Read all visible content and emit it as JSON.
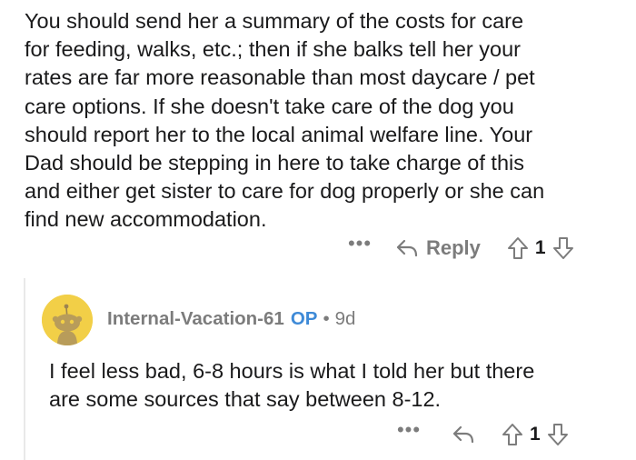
{
  "parent_comment": {
    "lines": [
      "You should send her a summary of the costs for care",
      "for feeding, walks, etc.; then if she balks tell her your",
      "rates are far more reasonable than most daycare / pet",
      "care options. If she doesn't take care of the dog you",
      "should report her to the local animal welfare line. Your",
      "Dad should be stepping in here to take charge of this",
      "and either get sister to care for dog properly or she can",
      "find new accommodation."
    ],
    "actions": {
      "more_label": "•••",
      "reply_label": "Reply",
      "vote_count": "1"
    }
  },
  "reply_comment": {
    "username": "Internal-Vacation-61",
    "op_badge": "OP",
    "separator": "•",
    "age": "9d",
    "lines": [
      "I feel less bad, 6-8 hours is what I told her but there",
      "are some sources that say between 8-12."
    ],
    "actions": {
      "more_label": "•••",
      "vote_count": "1"
    }
  },
  "colors": {
    "text": "#1a1a1b",
    "meta": "#7c7c7c",
    "op_badge": "#3e8ad7",
    "avatar_bg": "#f2cf47",
    "thread_line": "#e9e9e9"
  },
  "icons": {
    "reply": "reply-arrow-icon",
    "upvote": "upvote-arrow-icon",
    "downvote": "downvote-arrow-icon",
    "more": "ellipsis-icon",
    "avatar": "reddit-snoo-avatar"
  }
}
